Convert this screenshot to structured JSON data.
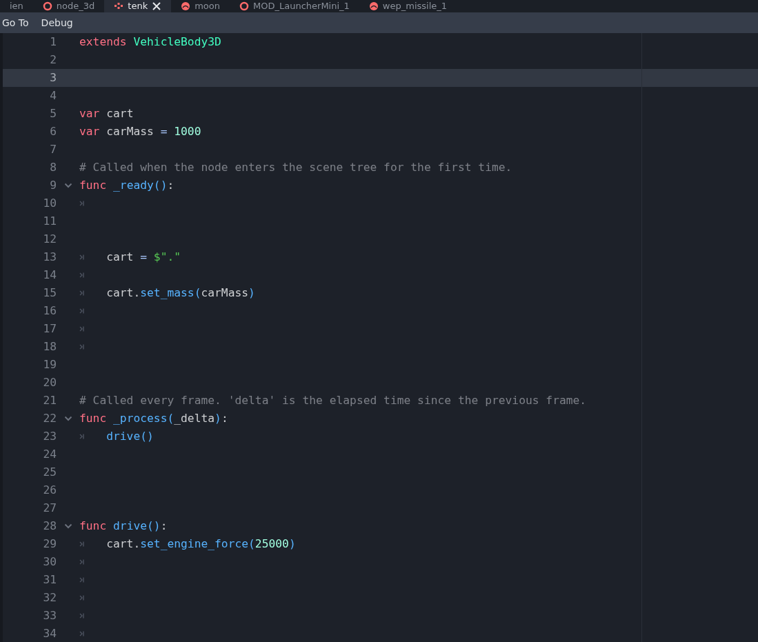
{
  "tabs": [
    {
      "label": "ien",
      "kind": "plain",
      "selected": false,
      "closable": false
    },
    {
      "label": "node_3d",
      "kind": "scene",
      "selected": false,
      "closable": false
    },
    {
      "label": "tenk",
      "kind": "vehicle",
      "selected": true,
      "closable": true
    },
    {
      "label": "moon",
      "kind": "world",
      "selected": false,
      "closable": false
    },
    {
      "label": "MOD_LauncherMini_1",
      "kind": "scene",
      "selected": false,
      "closable": false
    },
    {
      "label": "wep_missile_1",
      "kind": "world",
      "selected": false,
      "closable": false
    }
  ],
  "menu": [
    "Go To",
    "Debug"
  ],
  "lines": [
    {
      "number": "1",
      "fold": false,
      "current": false,
      "tokens": [
        {
          "kind": "keyword",
          "text": "extends"
        },
        {
          "kind": "type",
          "text": " VehicleBody3D"
        }
      ]
    },
    {
      "number": "2",
      "fold": false,
      "current": false
    },
    {
      "number": "3",
      "fold": false,
      "current": true
    },
    {
      "number": "4",
      "fold": false,
      "current": false
    },
    {
      "number": "5",
      "fold": false,
      "current": false,
      "tokens": [
        {
          "kind": "keyword",
          "text": "var"
        },
        {
          "kind": "plain",
          "text": " cart"
        }
      ]
    },
    {
      "number": "6",
      "fold": false,
      "current": false,
      "tokens": [
        {
          "kind": "keyword",
          "text": "var"
        },
        {
          "kind": "plain",
          "text": " carMass"
        },
        {
          "kind": "operator",
          "text": " ="
        },
        {
          "kind": "number",
          "text": " 1000"
        }
      ]
    },
    {
      "number": "7",
      "fold": false,
      "current": false
    },
    {
      "number": "8",
      "fold": false,
      "current": false,
      "tokens": [
        {
          "kind": "comment",
          "text": "# Called when the node enters the scene tree for the first time."
        }
      ]
    },
    {
      "number": "9",
      "fold": true,
      "current": false,
      "tokens": [
        {
          "kind": "keyword",
          "text": "func"
        },
        {
          "kind": "function",
          "text": " _ready"
        },
        {
          "kind": "call",
          "text": "()"
        },
        {
          "kind": "plain",
          "text": ":"
        }
      ]
    },
    {
      "number": "10",
      "fold": false,
      "current": false,
      "tokens": [
        {
          "kind": "indent"
        }
      ]
    },
    {
      "number": "11",
      "fold": false,
      "current": false
    },
    {
      "number": "12",
      "fold": false,
      "current": false
    },
    {
      "number": "13",
      "fold": false,
      "current": false,
      "tokens": [
        {
          "kind": "indent"
        },
        {
          "kind": "plain",
          "text": "cart"
        },
        {
          "kind": "operator",
          "text": " ="
        },
        {
          "kind": "string",
          "text": " $\".\""
        }
      ]
    },
    {
      "number": "14",
      "fold": false,
      "current": false,
      "tokens": [
        {
          "kind": "indent"
        }
      ]
    },
    {
      "number": "15",
      "fold": false,
      "current": false,
      "tokens": [
        {
          "kind": "indent"
        },
        {
          "kind": "plain",
          "text": "cart."
        },
        {
          "kind": "call",
          "text": "set_mass("
        },
        {
          "kind": "plain",
          "text": "carMass"
        },
        {
          "kind": "call",
          "text": ")"
        }
      ]
    },
    {
      "number": "16",
      "fold": false,
      "current": false,
      "tokens": [
        {
          "kind": "indent"
        }
      ]
    },
    {
      "number": "17",
      "fold": false,
      "current": false,
      "tokens": [
        {
          "kind": "indent"
        }
      ]
    },
    {
      "number": "18",
      "fold": false,
      "current": false,
      "tokens": [
        {
          "kind": "indent"
        }
      ]
    },
    {
      "number": "19",
      "fold": false,
      "current": false
    },
    {
      "number": "20",
      "fold": false,
      "current": false
    },
    {
      "number": "21",
      "fold": false,
      "current": false,
      "tokens": [
        {
          "kind": "comment",
          "text": "# Called every frame. 'delta' is the elapsed time since the previous frame."
        }
      ]
    },
    {
      "number": "22",
      "fold": true,
      "current": false,
      "tokens": [
        {
          "kind": "keyword",
          "text": "func"
        },
        {
          "kind": "function",
          "text": " _process"
        },
        {
          "kind": "call",
          "text": "("
        },
        {
          "kind": "plain",
          "text": "_delta"
        },
        {
          "kind": "call",
          "text": ")"
        },
        {
          "kind": "plain",
          "text": ":"
        }
      ]
    },
    {
      "number": "23",
      "fold": false,
      "current": false,
      "tokens": [
        {
          "kind": "indent"
        },
        {
          "kind": "call",
          "text": "drive()"
        }
      ]
    },
    {
      "number": "24",
      "fold": false,
      "current": false
    },
    {
      "number": "25",
      "fold": false,
      "current": false
    },
    {
      "number": "26",
      "fold": false,
      "current": false
    },
    {
      "number": "27",
      "fold": false,
      "current": false
    },
    {
      "number": "28",
      "fold": true,
      "current": false,
      "tokens": [
        {
          "kind": "keyword",
          "text": "func"
        },
        {
          "kind": "function",
          "text": " drive"
        },
        {
          "kind": "call",
          "text": "()"
        },
        {
          "kind": "plain",
          "text": ":"
        }
      ]
    },
    {
      "number": "29",
      "fold": false,
      "current": false,
      "tokens": [
        {
          "kind": "indent"
        },
        {
          "kind": "plain",
          "text": "cart."
        },
        {
          "kind": "call",
          "text": "set_engine_force("
        },
        {
          "kind": "number",
          "text": "25000"
        },
        {
          "kind": "call",
          "text": ")"
        }
      ]
    },
    {
      "number": "30",
      "fold": false,
      "current": false,
      "tokens": [
        {
          "kind": "indent"
        }
      ]
    },
    {
      "number": "31",
      "fold": false,
      "current": false,
      "tokens": [
        {
          "kind": "indent"
        }
      ]
    },
    {
      "number": "32",
      "fold": false,
      "current": false,
      "tokens": [
        {
          "kind": "indent"
        }
      ]
    },
    {
      "number": "33",
      "fold": false,
      "current": false,
      "tokens": [
        {
          "kind": "indent"
        }
      ]
    },
    {
      "number": "34",
      "fold": false,
      "current": false,
      "tokens": [
        {
          "kind": "indent"
        }
      ]
    }
  ]
}
